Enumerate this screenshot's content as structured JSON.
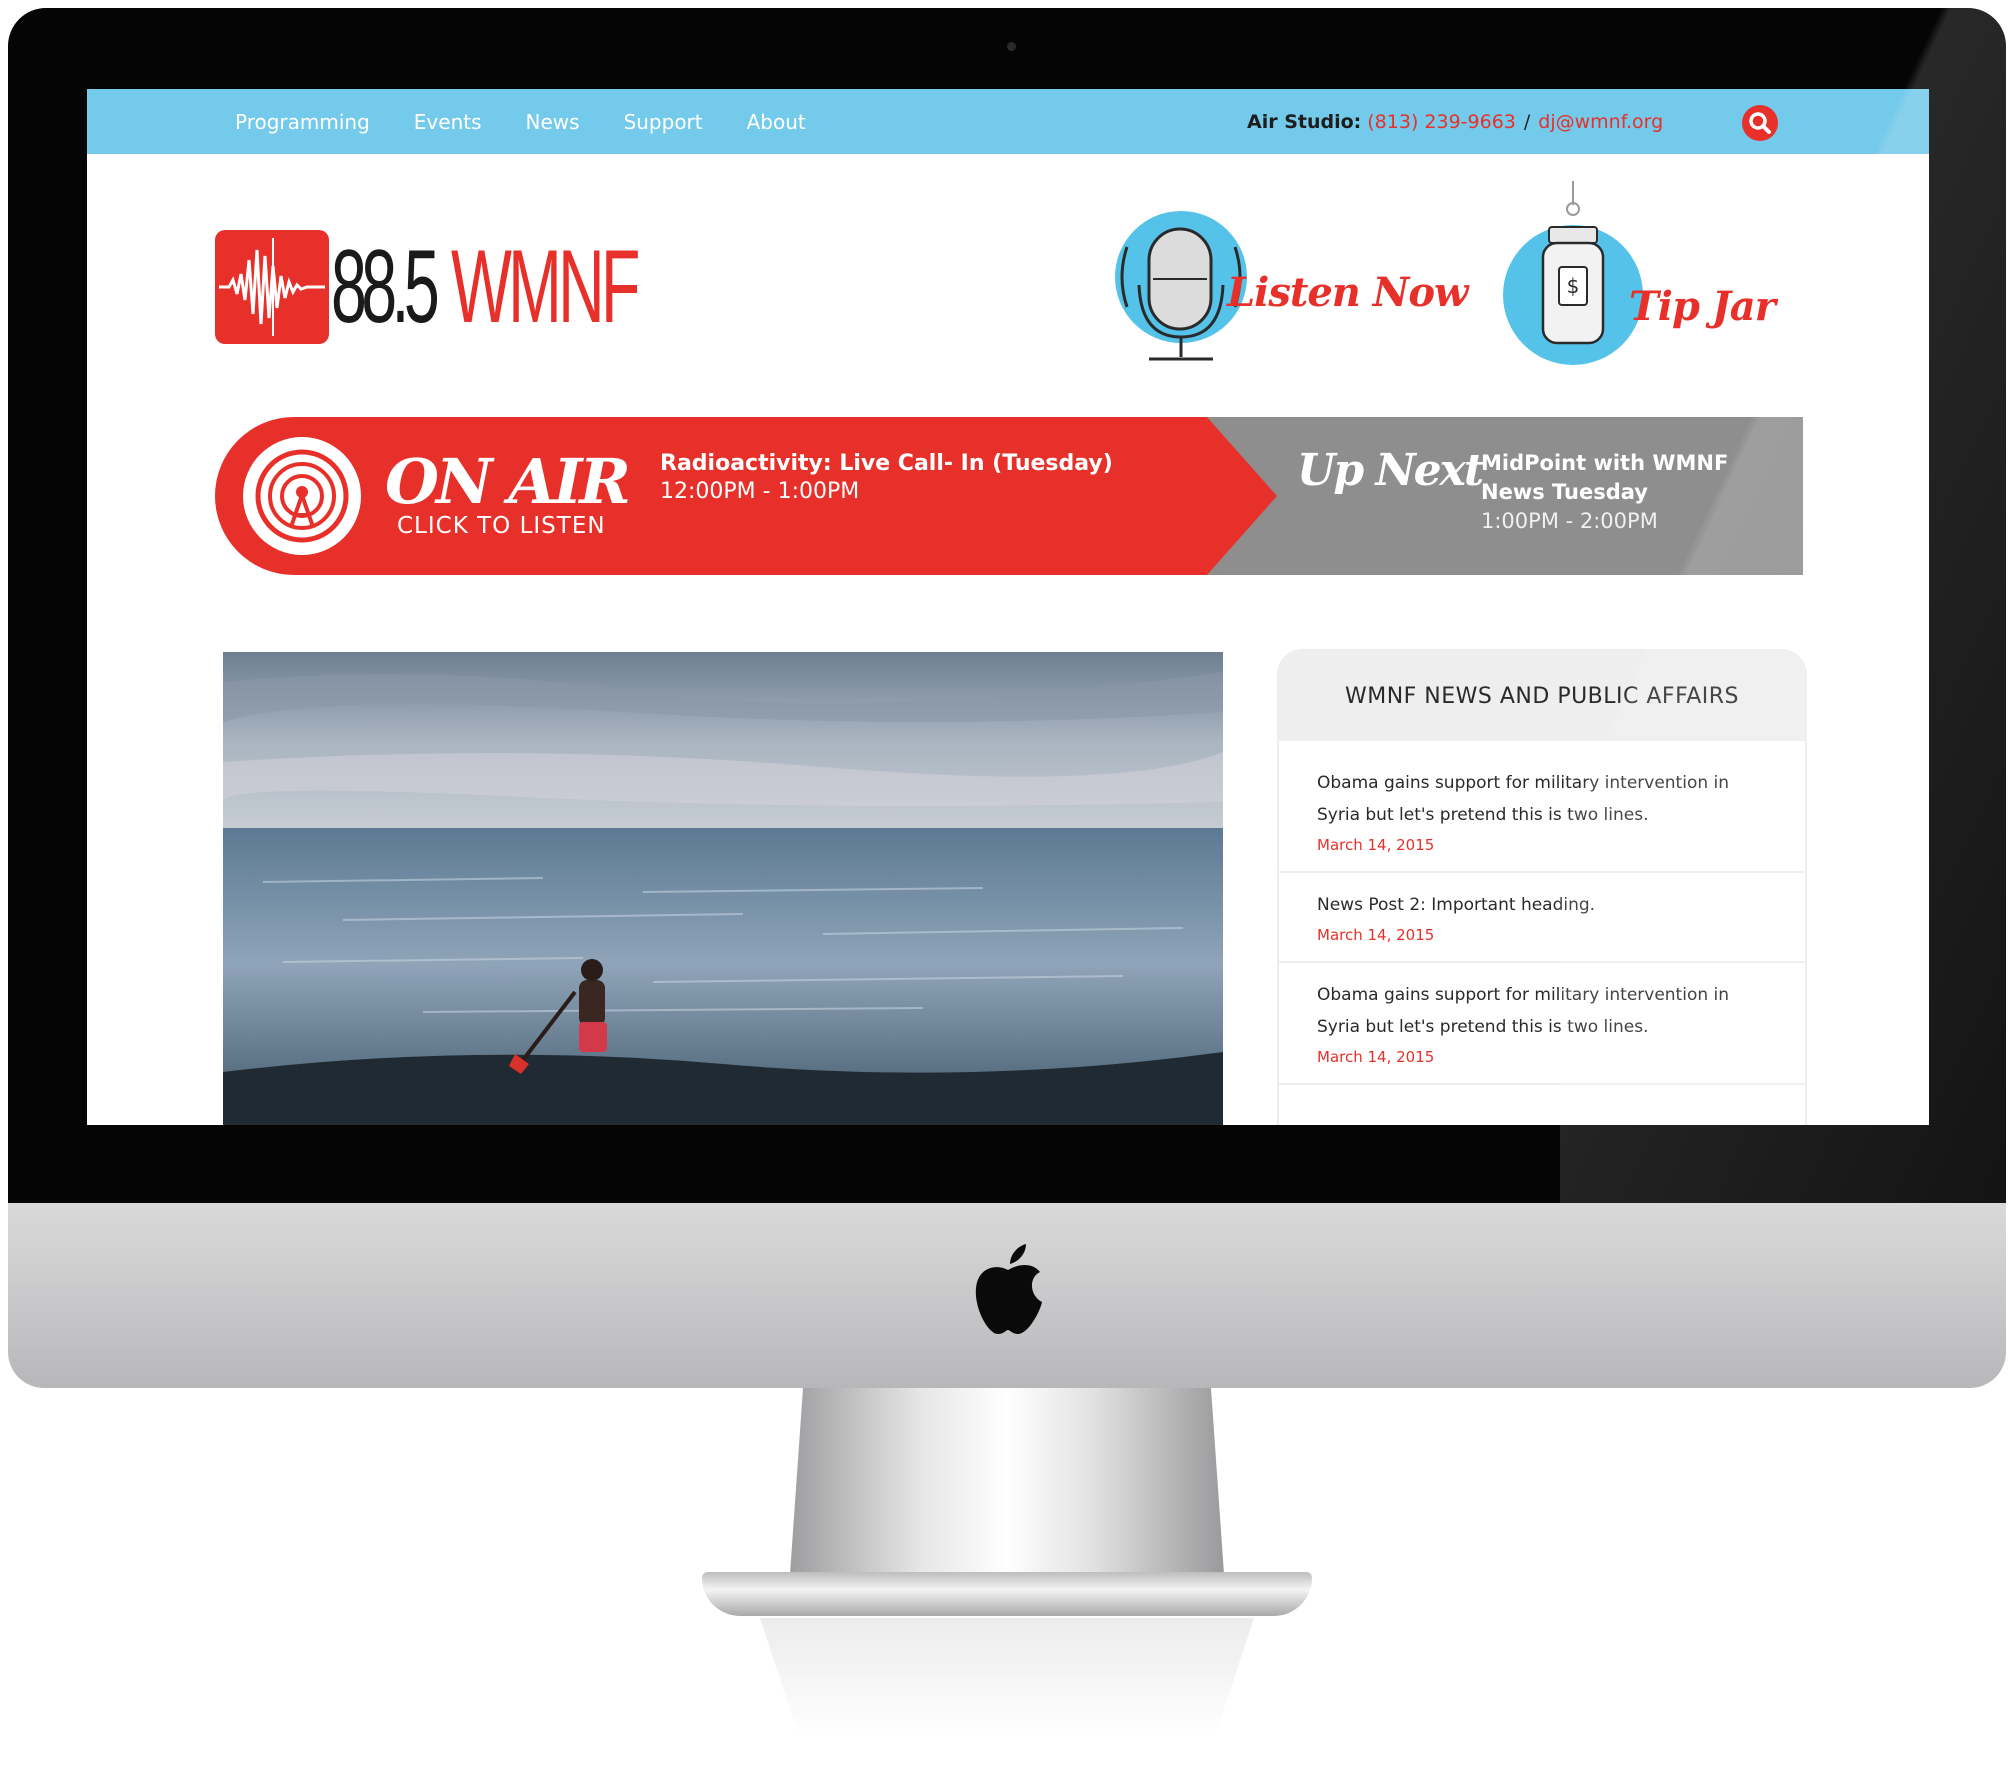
{
  "nav": {
    "items": [
      "Programming",
      "Events",
      "News",
      "Support",
      "About"
    ]
  },
  "air_studio": {
    "label": "Air Studio:",
    "phone": "(813) 239-9663",
    "separator": "/",
    "email": "dj@wmnf.org"
  },
  "logo": {
    "frequency": "88.5",
    "call_sign": "WMNF"
  },
  "header_buttons": {
    "listen": "Listen Now",
    "tip_jar": "Tip Jar",
    "tip_jar_symbol": "$"
  },
  "on_air": {
    "title": "ON AIR",
    "subtitle": "CLICK TO LISTEN",
    "show": "Radioactivity: Live Call- In (Tuesday)",
    "time": "12:00PM - 1:00PM"
  },
  "up_next": {
    "title": "Up Next",
    "show": "MidPoint with WMNF News Tuesday",
    "time": "1:00PM - 2:00PM"
  },
  "news_panel": {
    "heading": "WMNF NEWS AND PUBLIC AFFAIRS",
    "items": [
      {
        "title": "Obama gains support for military intervention in Syria but let's pretend this is two lines.",
        "date": "March 14, 2015"
      },
      {
        "title": "News Post 2: Important heading.",
        "date": "March 14, 2015"
      },
      {
        "title": "Obama gains support for military intervention in Syria but let's pretend this is two lines.",
        "date": "March 14, 2015"
      }
    ]
  },
  "colors": {
    "brand_red": "#e8302a",
    "topbar_blue": "#74caea",
    "up_next_gray": "#8e8e8e"
  },
  "icons": [
    "search-icon",
    "logo-waveform-icon",
    "microphone-icon",
    "tip-jar-icon",
    "radio-tower-icon",
    "apple-logo-icon"
  ]
}
